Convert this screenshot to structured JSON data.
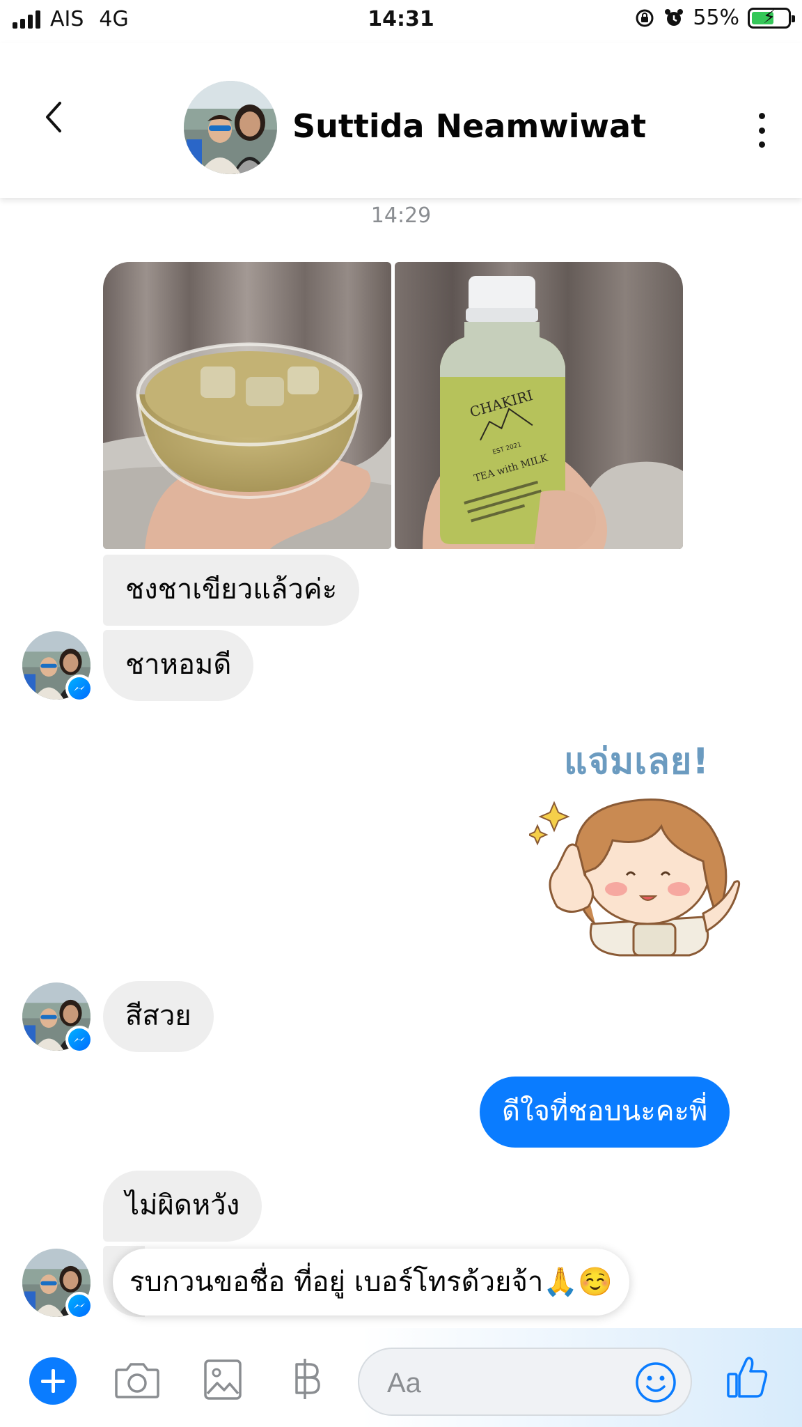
{
  "status_bar": {
    "carrier": "AIS",
    "network": "4G",
    "time": "14:31",
    "battery": "55%",
    "battery_level": 0.55
  },
  "header": {
    "contact_name": "Suttida Neamwiwat"
  },
  "chat": {
    "timestamp": "14:29",
    "messages_in": [
      "ชงชาเขียวแล้วค่ะ",
      "ชาหอมดี",
      "สีสวย",
      "ไม่ผิดหวัง",
      "รบกวนขอชื่อ ที่อยู่ เบอร์โทรด้วยจ้า🙏☺️"
    ],
    "message_out": "ดีใจที่ชอบนะคะพี่",
    "sticker_text": "แจ่มเลย!",
    "photo_label": {
      "brand": "CHAKIRI",
      "est": "EST 2021",
      "subtitle": "TEA with MILK"
    }
  },
  "composer": {
    "placeholder": "Aa"
  },
  "colors": {
    "accent": "#0a7cff",
    "incoming_bubble": "#eeeeee",
    "timestamp": "#8a8d91"
  },
  "icons": [
    "signal-icon",
    "alarm-icon",
    "rotation-lock-icon",
    "battery-icon",
    "back-arrow-icon",
    "more-icon",
    "messenger-badge-icon",
    "plus-icon",
    "camera-icon",
    "gallery-icon",
    "baht-icon",
    "emoji-icon",
    "thumbs-up-icon"
  ]
}
